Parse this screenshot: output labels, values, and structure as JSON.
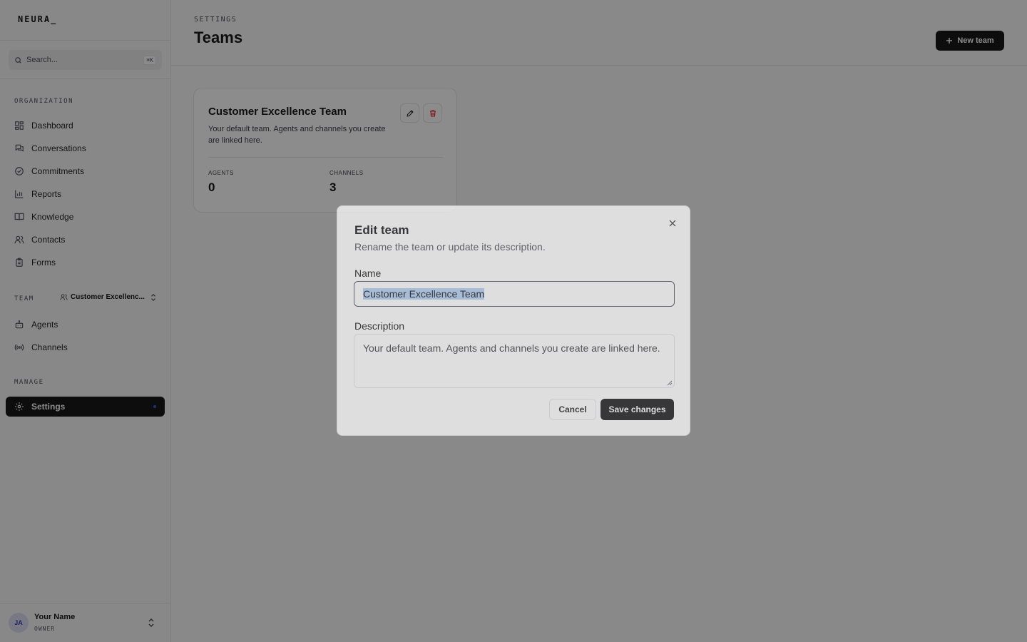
{
  "app": {
    "logo": "NEURA_"
  },
  "search": {
    "placeholder": "Search...",
    "shortcut": "⌘K"
  },
  "sidebar": {
    "org_label": "ORGANIZATION",
    "org_items": [
      {
        "label": "Dashboard",
        "icon": "dashboard-icon"
      },
      {
        "label": "Conversations",
        "icon": "chat-icon"
      },
      {
        "label": "Commitments",
        "icon": "check-circle-icon"
      },
      {
        "label": "Reports",
        "icon": "bar-chart-icon"
      },
      {
        "label": "Knowledge",
        "icon": "book-icon"
      },
      {
        "label": "Contacts",
        "icon": "users-icon"
      },
      {
        "label": "Forms",
        "icon": "clipboard-icon"
      }
    ],
    "team_label": "TEAM",
    "team_selector": "Customer Excellenc...",
    "team_items": [
      {
        "label": "Agents",
        "icon": "bot-icon"
      },
      {
        "label": "Channels",
        "icon": "radio-icon"
      }
    ],
    "manage_label": "MANAGE",
    "manage_items": [
      {
        "label": "Settings",
        "icon": "gear-icon",
        "active": true
      }
    ]
  },
  "user": {
    "initials": "JA",
    "name": "Your Name",
    "role": "OWNER"
  },
  "header": {
    "breadcrumb": "SETTINGS",
    "title": "Teams",
    "new_button": "New team"
  },
  "team_card": {
    "name": "Customer Excellence Team",
    "description": "Your default team. Agents and channels you create are linked here.",
    "stats": [
      {
        "label": "AGENTS",
        "value": "0"
      },
      {
        "label": "CHANNELS",
        "value": "3"
      }
    ]
  },
  "dialog": {
    "title": "Edit team",
    "subtitle": "Rename the team or update its description.",
    "name_label": "Name",
    "name_value": "Customer Excellence Team",
    "description_label": "Description",
    "description_value": "Your default team. Agents and channels you create are linked here.",
    "cancel_label": "Cancel",
    "save_label": "Save changes"
  },
  "colors": {
    "primary": "#18181b",
    "danger": "#dc2626",
    "accent_dot": "#3b5bdb"
  }
}
